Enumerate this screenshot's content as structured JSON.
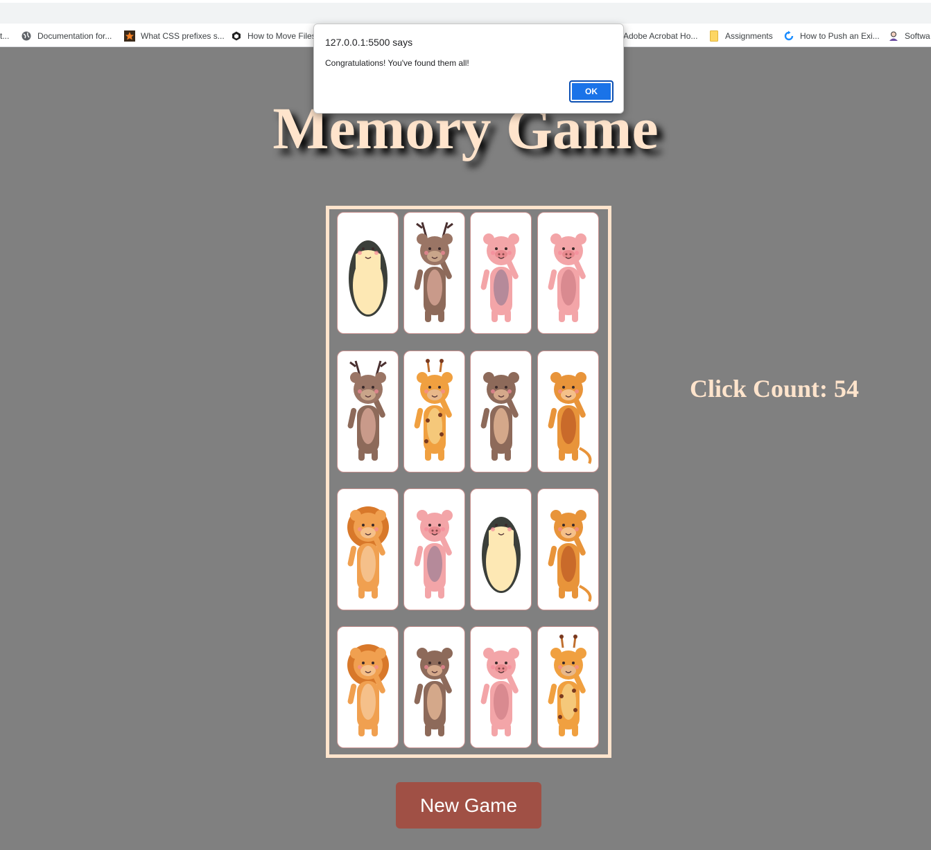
{
  "bookmarks": [
    {
      "label": "t...",
      "icon": "bookmark-icon"
    },
    {
      "label": "Documentation for...",
      "icon": "globe-icon"
    },
    {
      "label": "What CSS prefixes s...",
      "icon": "star-icon"
    },
    {
      "label": "How to Move Files",
      "icon": "hexagon-icon"
    },
    {
      "label": "Adobe Acrobat Ho...",
      "icon": "pdf-icon"
    },
    {
      "label": "Assignments",
      "icon": "folder-icon"
    },
    {
      "label": "How to Push an Exi...",
      "icon": "refresh-icon"
    },
    {
      "label": "Softwa",
      "icon": "avatar-icon"
    }
  ],
  "game": {
    "title": "Memory Game",
    "click_count_label": "Click Count: 54",
    "new_game_label": "New Game",
    "cards": [
      [
        "penguin",
        "deer",
        "pig-standing",
        "pig-waving"
      ],
      [
        "deer",
        "giraffe",
        "bear",
        "monkey"
      ],
      [
        "lion",
        "pig-standing",
        "penguin",
        "monkey"
      ],
      [
        "lion",
        "bear",
        "pig-waving",
        "giraffe"
      ]
    ]
  },
  "alert": {
    "origin": "127.0.0.1:5500 says",
    "message": "Congratulations! You've found them all!",
    "ok_label": "OK"
  },
  "colors": {
    "background": "#808080",
    "title": "#ffe4cc",
    "button": "#a05045",
    "ok": "#1a73e8"
  }
}
